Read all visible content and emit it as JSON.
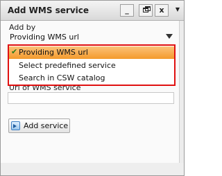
{
  "window": {
    "title": "Add WMS service",
    "minimize_glyph": "_",
    "close_glyph": "x",
    "menu_glyph": "▼"
  },
  "form": {
    "add_by_label": "Add by",
    "add_by_selected": "Providing WMS url",
    "options": [
      "Providing WMS url",
      "Select predefined service",
      "Search in CSW catalog"
    ],
    "checkmark": "✔",
    "url_label": "Url of WMS service",
    "url_value": "",
    "add_button_label": "Add service"
  },
  "colors": {
    "highlight_border": "#e01010",
    "selected_option": "#f6a640"
  },
  "icons": {
    "minimize": "minimize-icon",
    "maximize": "restore-icon",
    "close": "close-icon",
    "menu": "menu-dropdown-icon",
    "select_arrow": "chevron-down-icon",
    "add": "add-service-icon",
    "check": "check-icon"
  }
}
